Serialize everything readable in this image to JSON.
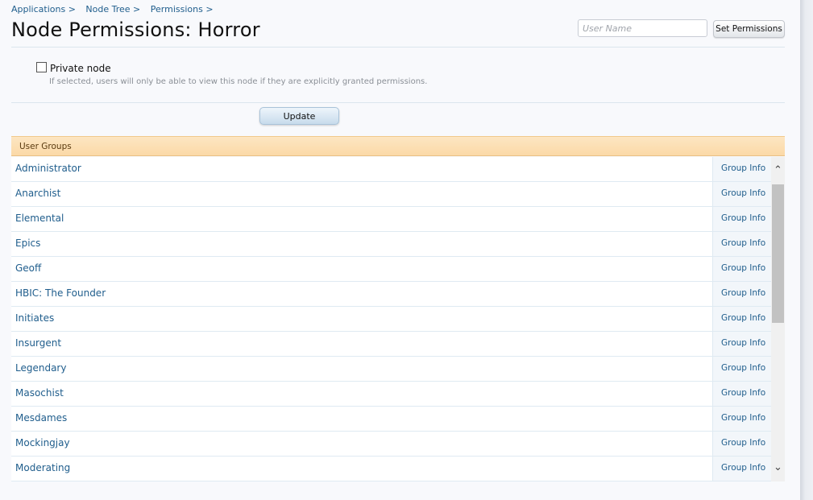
{
  "breadcrumb": [
    {
      "label": "Applications",
      "sep": ">"
    },
    {
      "label": "Node Tree",
      "sep": ">"
    },
    {
      "label": "Permissions",
      "sep": ">"
    }
  ],
  "page_title": "Node Permissions: Horror",
  "user_search": {
    "placeholder": "User Name",
    "value": "",
    "button_label": "Set Permissions"
  },
  "private_node": {
    "checked": false,
    "label": "Private node",
    "hint": "If selected, users will only be able to view this node if they are explicitly granted permissions."
  },
  "update_label": "Update",
  "user_groups": {
    "header": "User Groups",
    "info_label": "Group Info",
    "items": [
      "Administrator",
      "Anarchist",
      "Elemental",
      "Epics",
      "Geoff",
      "HBIC: The Founder",
      "Initiates",
      "Insurgent",
      "Legendary",
      "Masochist",
      "Mesdames",
      "Mockingjay",
      "Moderating"
    ]
  },
  "icons": {
    "scroll_up": "chevron-up-icon",
    "scroll_down": "chevron-down-icon"
  },
  "colors": {
    "link": "#1f5d8c",
    "header_bg": "#fbd9a7",
    "page_bg": "#f8f9fc"
  }
}
